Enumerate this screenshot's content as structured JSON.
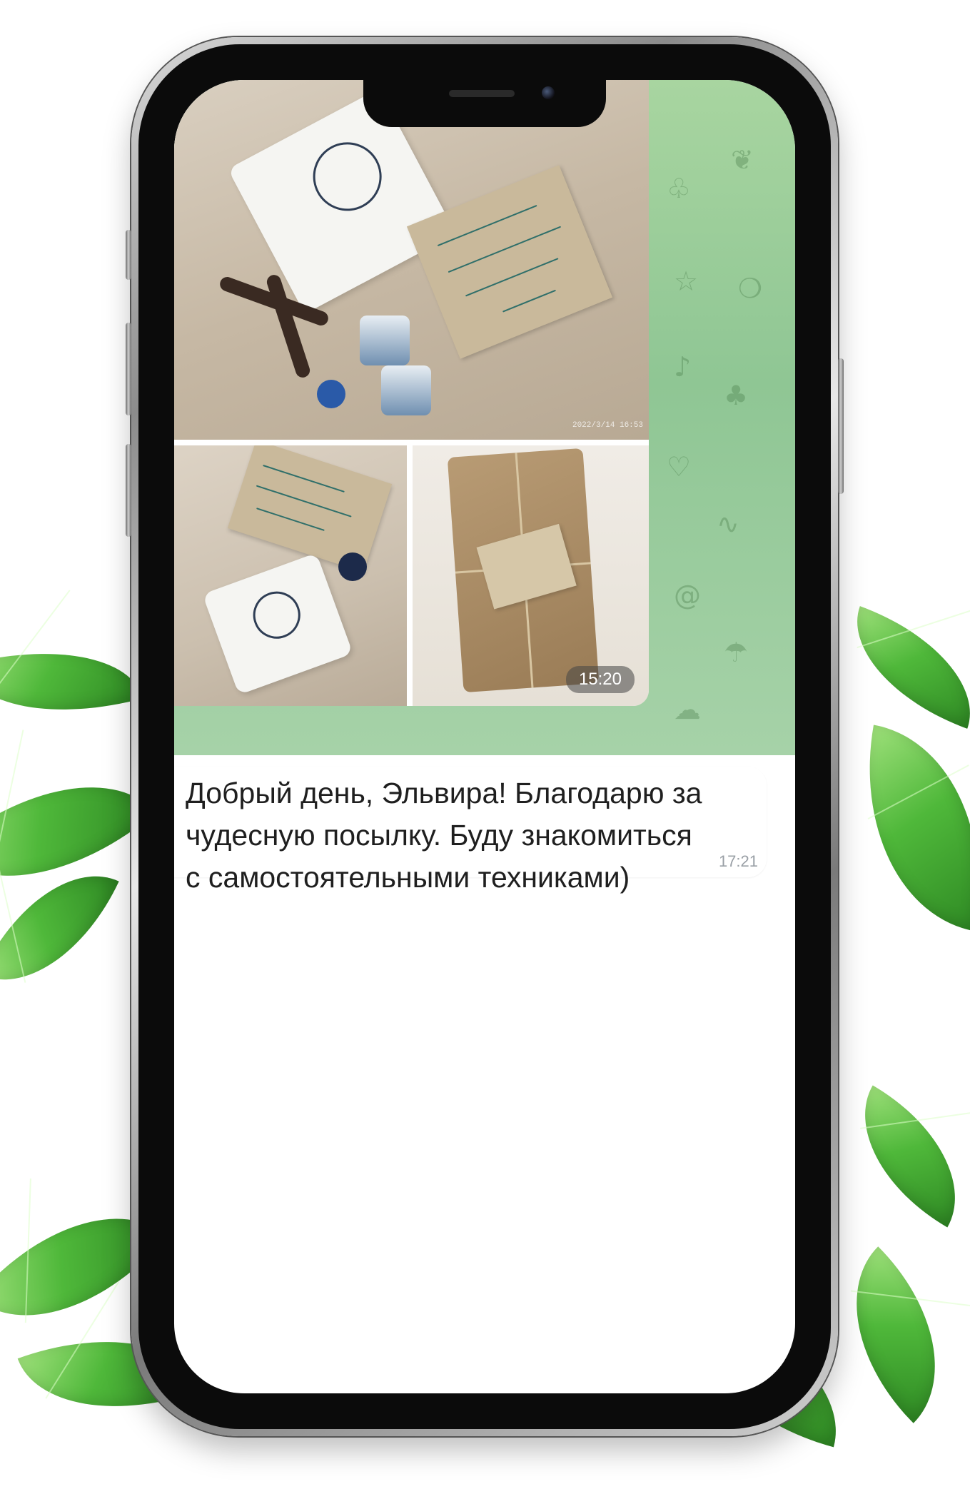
{
  "album": {
    "photo_datestamp": "2022/3/14 16:53",
    "time": "15:20"
  },
  "message": {
    "text": "Добрый день, Эльвира! Благодарю за\nчудесную посылку. Буду знакомиться\nс самостоятельными техниками)",
    "time": "17:21"
  },
  "colors": {
    "wallpaper": "#a8d5a0",
    "bubble": "#ffffff",
    "leaf": "#4fb83a"
  }
}
